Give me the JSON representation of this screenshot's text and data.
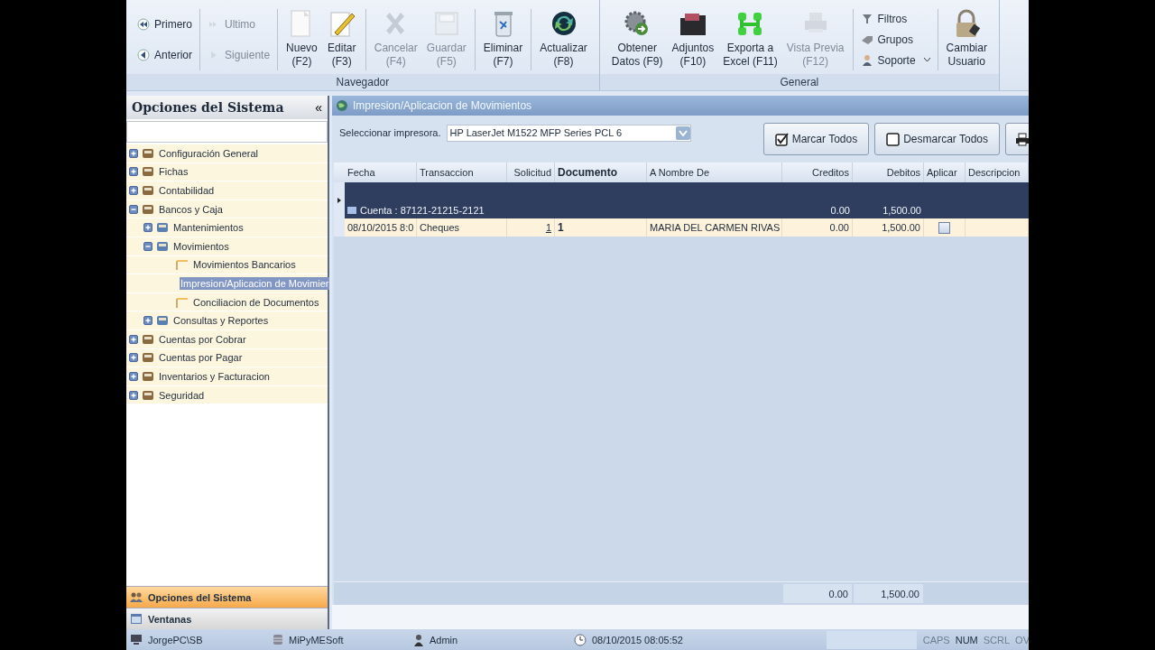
{
  "ribbon": {
    "groups": [
      {
        "label": "Navegador",
        "sections": [
          [
            {
              "kind": "small",
              "label": "Primero",
              "disabled": false
            },
            {
              "kind": "small",
              "label": "Anterior",
              "disabled": false
            }
          ],
          [
            {
              "kind": "small",
              "label": "Ultimo",
              "disabled": true
            },
            {
              "kind": "small",
              "label": "Siguiente",
              "disabled": true
            }
          ],
          [
            {
              "kind": "large",
              "label": "Nuevo\n(F2)",
              "disabled": false
            },
            {
              "kind": "large",
              "label": "Editar\n(F3)",
              "disabled": false
            }
          ],
          [
            {
              "kind": "large",
              "label": "Cancelar\n(F4)",
              "disabled": true
            },
            {
              "kind": "large",
              "label": "Guardar\n(F5)",
              "disabled": true
            }
          ],
          [
            {
              "kind": "large",
              "label": "Eliminar\n(F7)",
              "disabled": false
            }
          ],
          [
            {
              "kind": "large",
              "label": "Actualizar\n(F8)",
              "disabled": false
            }
          ]
        ]
      },
      {
        "label": "General",
        "sections": [
          [
            {
              "kind": "large",
              "label": "Obtener\nDatos (F9)",
              "disabled": false
            },
            {
              "kind": "large",
              "label": "Adjuntos\n(F10)",
              "disabled": false
            },
            {
              "kind": "large",
              "label": "Exporta a\nExcel (F11)",
              "disabled": false
            },
            {
              "kind": "large",
              "label": "Vista Previa\n(F12)",
              "disabled": true
            }
          ],
          [
            {
              "kind": "small",
              "label": "Filtros",
              "disabled": false
            },
            {
              "kind": "small",
              "label": "Grupos",
              "disabled": false
            },
            {
              "kind": "dropdown",
              "label": "Soporte",
              "disabled": false
            }
          ],
          [
            {
              "kind": "large",
              "label": "Cambiar\nUsuario",
              "disabled": false
            }
          ]
        ]
      }
    ]
  },
  "sidebar": {
    "title": "Opciones del Sistema",
    "collapse": "«",
    "tree": [
      {
        "label": "Configuración General",
        "expanded": false,
        "selected": false
      },
      {
        "label": "Fichas",
        "expanded": false,
        "selected": false
      },
      {
        "label": "Contabilidad",
        "expanded": false,
        "selected": false
      },
      {
        "label": "Bancos y Caja",
        "expanded": true,
        "selected": false,
        "children": [
          {
            "label": "Mantenimientos",
            "expanded": false,
            "selected": false
          },
          {
            "label": "Movimientos",
            "expanded": true,
            "selected": false,
            "children": [
              {
                "label": "Movimientos Bancarios",
                "selected": false
              },
              {
                "label": "Impresion/Aplicacion de Movimier",
                "selected": true
              },
              {
                "label": "Conciliacion de Documentos",
                "selected": false
              }
            ]
          },
          {
            "label": "Consultas y Reportes",
            "expanded": false,
            "selected": false
          }
        ]
      },
      {
        "label": "Cuentas por Cobrar",
        "expanded": false,
        "selected": false
      },
      {
        "label": "Cuentas por Pagar",
        "expanded": false,
        "selected": false
      },
      {
        "label": "Inventarios y Facturacion",
        "expanded": false,
        "selected": false
      },
      {
        "label": "Seguridad",
        "expanded": false,
        "selected": false
      }
    ],
    "panes": [
      {
        "label": "Opciones del Sistema",
        "selected": true
      },
      {
        "label": "Ventanas",
        "selected": false
      }
    ]
  },
  "main": {
    "title": "Impresion/Aplicacion de Movimientos",
    "printer_label": "Seleccionar impresora.",
    "printer": "HP LaserJet M1522 MFP Series PCL 6",
    "buttons": [
      {
        "kind": "check",
        "label": "Marcar Todos"
      },
      {
        "kind": "uncheck",
        "label": "Desmarcar Todos"
      },
      {
        "kind": "print"
      }
    ],
    "table": {
      "columns": [
        {
          "label": "Fecha",
          "emphasized": false
        },
        {
          "label": "Transaccion",
          "emphasized": false
        },
        {
          "label": "Solicitud",
          "emphasized": false
        },
        {
          "label": "Documento",
          "emphasized": true
        },
        {
          "label": "A Nombre De",
          "emphasized": false
        },
        {
          "label": "Creditos",
          "emphasized": false
        },
        {
          "label": "Debitos",
          "emphasized": false
        },
        {
          "label": "Aplicar",
          "emphasized": false
        },
        {
          "label": "Descripcion",
          "emphasized": false
        }
      ],
      "group": {
        "label": "Cuenta : 87121-21215-2121",
        "creditos": "0.00",
        "debitos": "1,500.00"
      },
      "rows": [
        {
          "fecha": "08/10/2015 8:0",
          "transaccion": "Cheques",
          "solicitud": "1",
          "documento": "1",
          "nombre": "MARIA DEL CARMEN RIVAS",
          "creditos": "0.00",
          "debitos": "1,500.00",
          "aplicar": false
        }
      ],
      "totals": {
        "creditos": "0.00",
        "debitos": "1,500.00"
      }
    }
  },
  "status_bar": {
    "computer": "JorgePC\\SB",
    "database": "MiPyMESoft",
    "user": "Admin",
    "datetime": "08/10/2015 08:05:52",
    "indicators": [
      {
        "label": "CAPS",
        "on": false
      },
      {
        "label": "NUM",
        "on": true
      },
      {
        "label": "SCRL",
        "on": false
      },
      {
        "label": "OV",
        "on": false
      }
    ]
  }
}
